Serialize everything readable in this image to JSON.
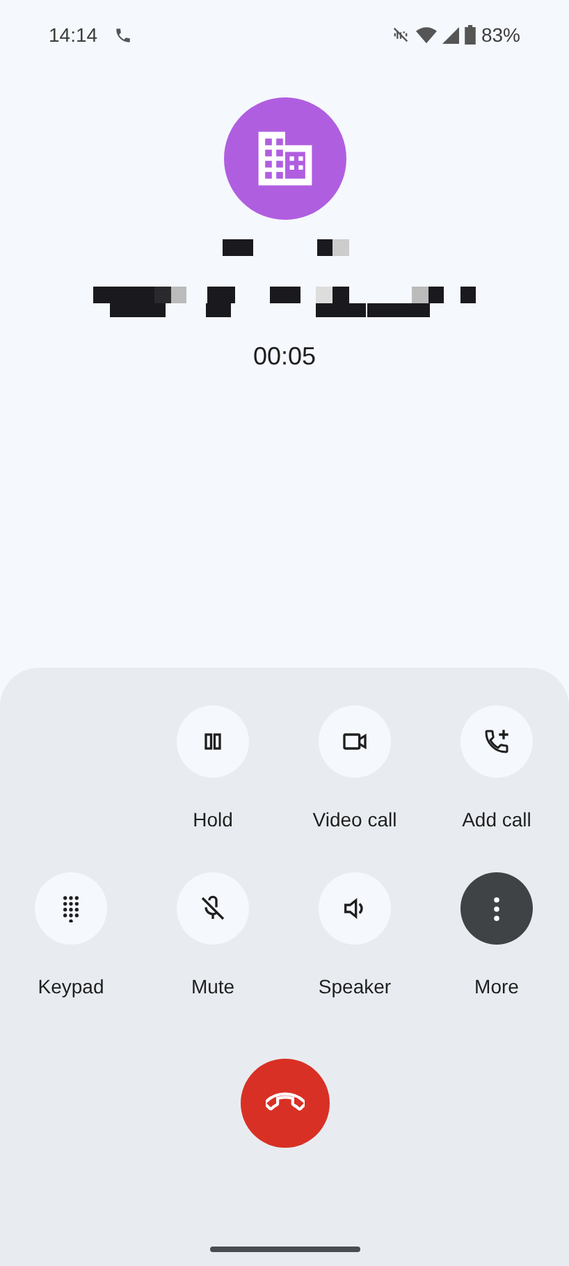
{
  "status_bar": {
    "time": "14:14",
    "battery": "83%"
  },
  "caller": {
    "timer": "00:05"
  },
  "controls": [
    {
      "buttons": [
        {
          "kind": "hold",
          "label": "Hold",
          "selected": false
        },
        {
          "kind": "video",
          "label": "Video call",
          "selected": false
        },
        {
          "kind": "add",
          "label": "Add call",
          "selected": false
        }
      ]
    },
    {
      "buttons": [
        {
          "kind": "keypad",
          "label": "Keypad",
          "selected": false
        },
        {
          "kind": "mute",
          "label": "Mute",
          "selected": false
        },
        {
          "kind": "speaker",
          "label": "Speaker",
          "selected": false
        },
        {
          "kind": "more",
          "label": "More",
          "selected": true
        }
      ]
    }
  ]
}
